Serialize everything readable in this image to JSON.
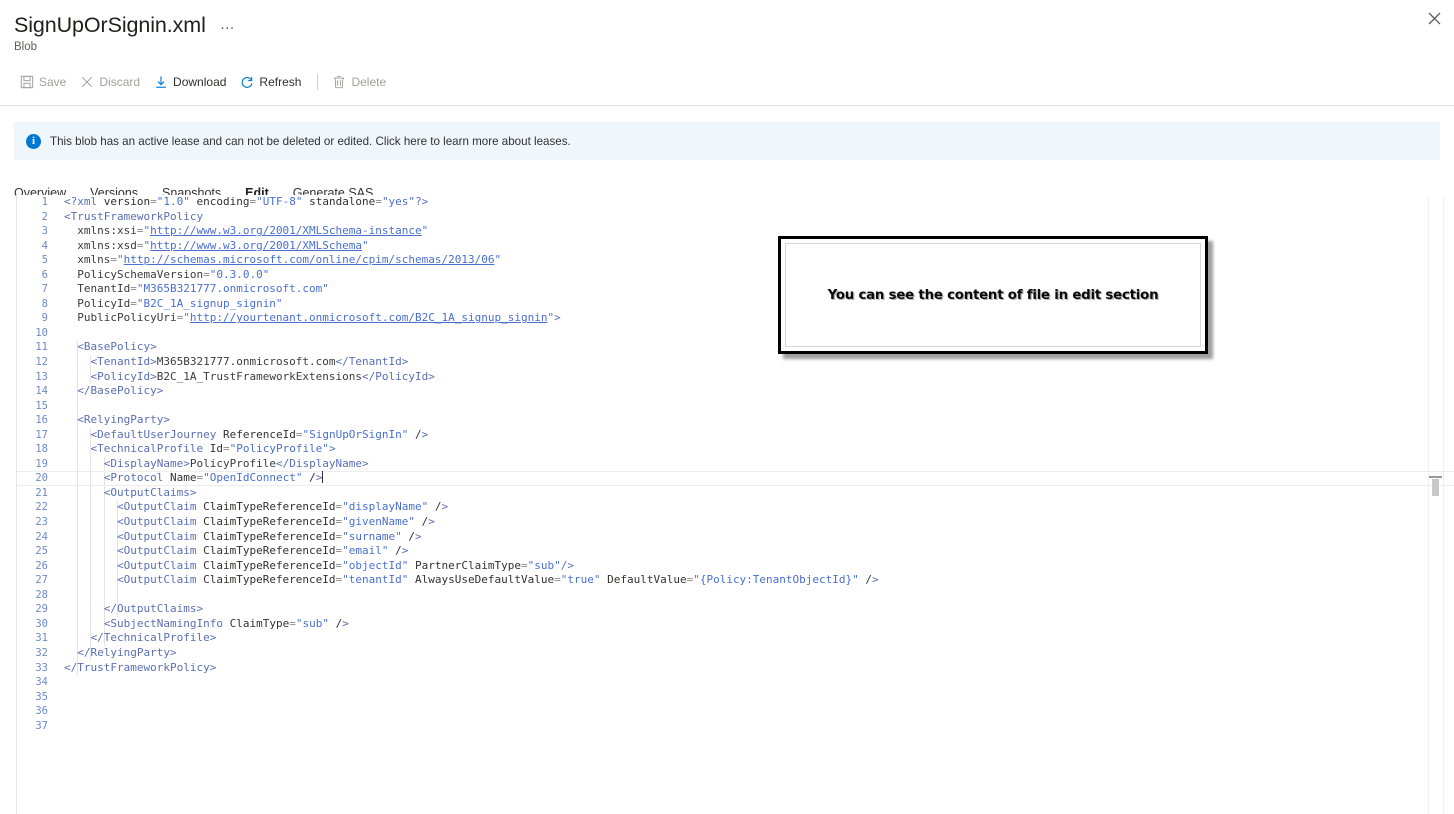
{
  "header": {
    "title": "SignUpOrSignin.xml",
    "subtitle": "Blob",
    "ellipsis": "…",
    "close_label": "Close"
  },
  "commandbar": {
    "items": [
      {
        "label": "Save",
        "icon": "save-icon",
        "disabled": true
      },
      {
        "label": "Discard",
        "icon": "discard-icon",
        "disabled": true
      },
      {
        "label": "Download",
        "icon": "download-icon",
        "disabled": false
      },
      {
        "label": "Refresh",
        "icon": "refresh-icon",
        "disabled": false
      },
      {
        "label": "Delete",
        "icon": "delete-icon",
        "disabled": true
      }
    ]
  },
  "banner": {
    "icon": "info-icon",
    "glyph": "i",
    "message": "This blob has an active lease and can not be deleted or edited. Click here to learn more about leases.",
    "background": "#eff6fc",
    "accent": "#0078d4"
  },
  "tabs": {
    "items": [
      "Overview",
      "Versions",
      "Snapshots",
      "Edit",
      "Generate SAS"
    ],
    "active": "Edit",
    "accent": "#0078d4"
  },
  "annotation": {
    "text": "You can see the content of file in edit section"
  },
  "editor": {
    "language": "xml",
    "total_lines": 37,
    "current_line": 20,
    "cursor_line": 20,
    "lines": [
      {
        "n": 1,
        "text": "<?xml version=\"1.0\" encoding=\"UTF-8\" standalone=\"yes\"?>"
      },
      {
        "n": 2,
        "text": "<TrustFrameworkPolicy"
      },
      {
        "n": 3,
        "text": "  xmlns:xsi=\"http://www.w3.org/2001/XMLSchema-instance\""
      },
      {
        "n": 4,
        "text": "  xmlns:xsd=\"http://www.w3.org/2001/XMLSchema\""
      },
      {
        "n": 5,
        "text": "  xmlns=\"http://schemas.microsoft.com/online/cpim/schemas/2013/06\""
      },
      {
        "n": 6,
        "text": "  PolicySchemaVersion=\"0.3.0.0\""
      },
      {
        "n": 7,
        "text": "  TenantId=\"M365B321777.onmicrosoft.com\""
      },
      {
        "n": 8,
        "text": "  PolicyId=\"B2C_1A_signup_signin\""
      },
      {
        "n": 9,
        "text": "  PublicPolicyUri=\"http://yourtenant.onmicrosoft.com/B2C_1A_signup_signin\">"
      },
      {
        "n": 10,
        "text": ""
      },
      {
        "n": 11,
        "text": "  <BasePolicy>"
      },
      {
        "n": 12,
        "text": "    <TenantId>M365B321777.onmicrosoft.com</TenantId>"
      },
      {
        "n": 13,
        "text": "    <PolicyId>B2C_1A_TrustFrameworkExtensions</PolicyId>"
      },
      {
        "n": 14,
        "text": "  </BasePolicy>"
      },
      {
        "n": 15,
        "text": ""
      },
      {
        "n": 16,
        "text": "  <RelyingParty>"
      },
      {
        "n": 17,
        "text": "    <DefaultUserJourney ReferenceId=\"SignUpOrSignIn\" />"
      },
      {
        "n": 18,
        "text": "    <TechnicalProfile Id=\"PolicyProfile\">"
      },
      {
        "n": 19,
        "text": "      <DisplayName>PolicyProfile</DisplayName>"
      },
      {
        "n": 20,
        "text": "      <Protocol Name=\"OpenIdConnect\" />"
      },
      {
        "n": 21,
        "text": "      <OutputClaims>"
      },
      {
        "n": 22,
        "text": "        <OutputClaim ClaimTypeReferenceId=\"displayName\" />"
      },
      {
        "n": 23,
        "text": "        <OutputClaim ClaimTypeReferenceId=\"givenName\" />"
      },
      {
        "n": 24,
        "text": "        <OutputClaim ClaimTypeReferenceId=\"surname\" />"
      },
      {
        "n": 25,
        "text": "        <OutputClaim ClaimTypeReferenceId=\"email\" />"
      },
      {
        "n": 26,
        "text": "        <OutputClaim ClaimTypeReferenceId=\"objectId\" PartnerClaimType=\"sub\"/>"
      },
      {
        "n": 27,
        "text": "        <OutputClaim ClaimTypeReferenceId=\"tenantId\" AlwaysUseDefaultValue=\"true\" DefaultValue=\"{Policy:TenantObjectId}\" />"
      },
      {
        "n": 28,
        "text": ""
      },
      {
        "n": 29,
        "text": "      </OutputClaims>"
      },
      {
        "n": 30,
        "text": "      <SubjectNamingInfo ClaimType=\"sub\" />"
      },
      {
        "n": 31,
        "text": "    </TechnicalProfile>"
      },
      {
        "n": 32,
        "text": "  </RelyingParty>"
      },
      {
        "n": 33,
        "text": "</TrustFrameworkPolicy>"
      },
      {
        "n": 34,
        "text": ""
      },
      {
        "n": 35,
        "text": ""
      },
      {
        "n": 36,
        "text": ""
      },
      {
        "n": 37,
        "text": ""
      }
    ]
  }
}
